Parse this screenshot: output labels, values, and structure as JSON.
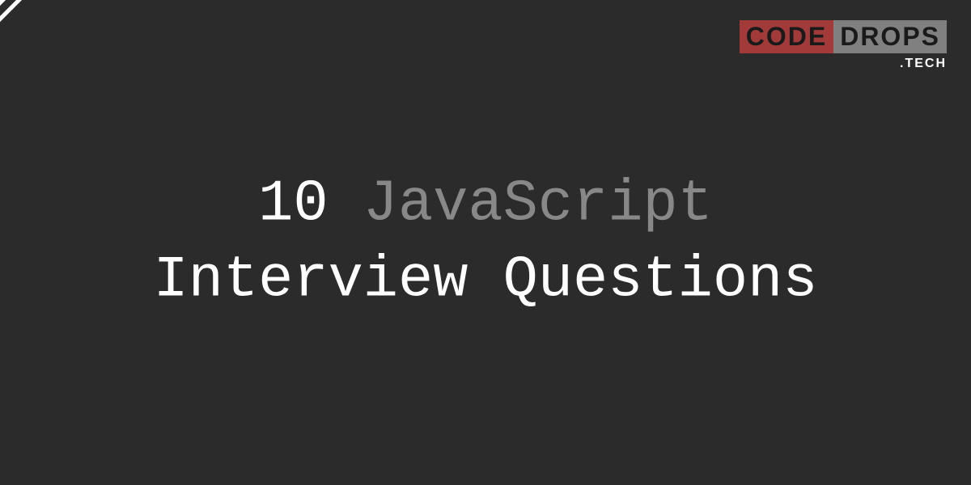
{
  "logo": {
    "code": "CODE",
    "drops": "DROPS",
    "tech": ".TECH"
  },
  "title": {
    "number": "10",
    "javascript": " JavaScript",
    "line2": "Interview Questions"
  },
  "colors": {
    "background": "#2b2b2b",
    "white": "#ffffff",
    "gray": "#888888",
    "logoRed": "#a33a3a",
    "logoGray": "#808080"
  }
}
